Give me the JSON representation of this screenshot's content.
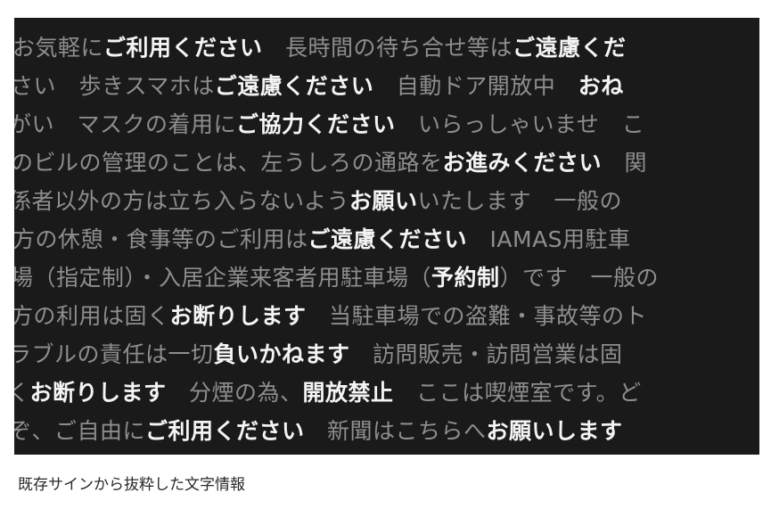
{
  "lines": [
    [
      {
        "t": "お気軽に",
        "s": "g"
      },
      {
        "t": "ご利用ください",
        "s": "w"
      },
      {
        "t": "　長時間の待ち合せ等は",
        "s": "g"
      },
      {
        "t": "ご遠慮くだ",
        "s": "w"
      }
    ],
    [
      {
        "t": "さい　歩きスマホは",
        "s": "g"
      },
      {
        "t": "ご遠慮ください",
        "s": "w"
      },
      {
        "t": "　自動ドア開放中　",
        "s": "g"
      },
      {
        "t": "おね",
        "s": "w"
      }
    ],
    [
      {
        "t": "がい　マスクの着用に",
        "s": "g"
      },
      {
        "t": "ご協力ください",
        "s": "w"
      },
      {
        "t": "　いらっしゃいませ　こ",
        "s": "g"
      }
    ],
    [
      {
        "t": "のビルの管理のことは、左うしろの通路を",
        "s": "g"
      },
      {
        "t": "お進みください",
        "s": "w"
      },
      {
        "t": "　関",
        "s": "g"
      }
    ],
    [
      {
        "t": "係者以外の方は立ち入らないよう",
        "s": "g"
      },
      {
        "t": "お願い",
        "s": "w"
      },
      {
        "t": "いたします　一般の",
        "s": "g"
      }
    ],
    [
      {
        "t": "方の休憩・食事等のご利用は",
        "s": "g"
      },
      {
        "t": "ご遠慮ください",
        "s": "w"
      },
      {
        "t": "　IAMAS用駐車",
        "s": "g"
      }
    ],
    [
      {
        "t": "場（指定制）・入居企業来客者用駐車場（",
        "s": "g"
      },
      {
        "t": "予約制",
        "s": "w"
      },
      {
        "t": "）です　一般の",
        "s": "g"
      }
    ],
    [
      {
        "t": "方の利用は固く",
        "s": "g"
      },
      {
        "t": "お断りします",
        "s": "w"
      },
      {
        "t": "　当駐車場での盗難・事故等のト",
        "s": "g"
      }
    ],
    [
      {
        "t": "ラブルの責任は一切",
        "s": "g"
      },
      {
        "t": "負いかねます",
        "s": "w"
      },
      {
        "t": "　訪問販売・訪問営業は固",
        "s": "g"
      }
    ],
    [
      {
        "t": "く",
        "s": "g"
      },
      {
        "t": "お断りします",
        "s": "w"
      },
      {
        "t": "　分煙の為、",
        "s": "g"
      },
      {
        "t": "開放禁止",
        "s": "w"
      },
      {
        "t": "　ここは喫煙室です。ど",
        "s": "g"
      }
    ],
    [
      {
        "t": "ぞ、ご自由に",
        "s": "g"
      },
      {
        "t": "ご利用ください",
        "s": "w"
      },
      {
        "t": "　新聞はこちらへ",
        "s": "g"
      },
      {
        "t": "お願いします",
        "s": "w"
      }
    ]
  ],
  "caption": "既存サインから抜粋した文字情報",
  "colors": {
    "panel_bg": "#1b1a1a",
    "text_gray": "#8e8e8e",
    "text_white": "#f4f4f4"
  }
}
